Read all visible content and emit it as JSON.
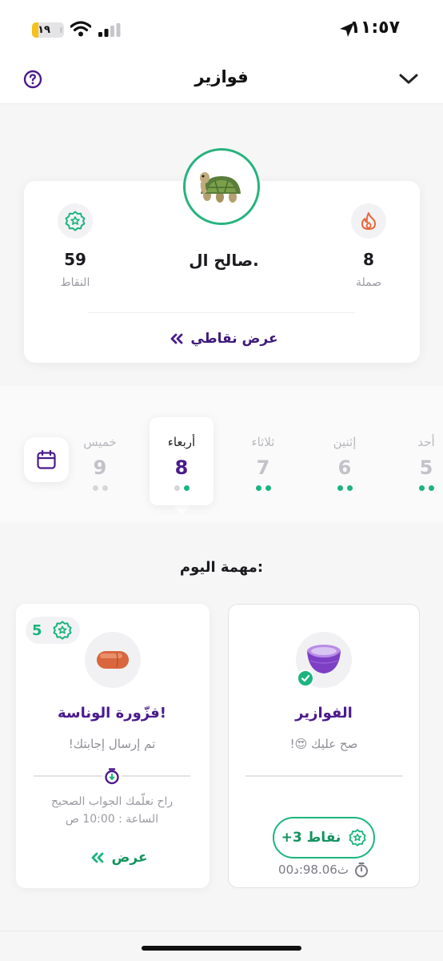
{
  "status_bar": {
    "time": "١١:٥٧",
    "battery_level": "١٩",
    "battery_fraction": 0.19,
    "icons": [
      "location-arrow-icon",
      "signal-icon",
      "wifi-icon",
      "battery-icon"
    ]
  },
  "header": {
    "title": "فوازير",
    "left_icon": "help-circle-icon",
    "right_icon": "chevron-down-icon"
  },
  "profile": {
    "user_name": "صالح ال.",
    "avatar_icon": "turtle-icon",
    "streak": {
      "value": "8",
      "label": "صملة",
      "icon": "flame-icon"
    },
    "points": {
      "value": "59",
      "label": "النقاط",
      "icon": "star-badge-icon"
    },
    "link_label": "عرض نقاطي"
  },
  "days": [
    {
      "name": "أحد",
      "number": "5",
      "dots": [
        "green",
        "green"
      ]
    },
    {
      "name": "إثنين",
      "number": "6",
      "dots": [
        "green",
        "green"
      ]
    },
    {
      "name": "ثلاثاء",
      "number": "7",
      "dots": [
        "green",
        "green"
      ]
    },
    {
      "name": "أربعاء",
      "number": "8",
      "dots": [
        "grey",
        "green"
      ],
      "selected": true
    },
    {
      "name": "خميس",
      "number": "9",
      "dots": [
        "grey",
        "grey"
      ]
    }
  ],
  "task_section": {
    "title": "مهمة اليوم:"
  },
  "tasks": {
    "fawazir": {
      "name": "الفوازير",
      "subtitle": "صح عليك 😍!",
      "points_label": "+3 نقاط",
      "timer": "ث98.06:د00",
      "completed": true,
      "icon": "bowl-icon"
    },
    "nawasa": {
      "name": "فزّورة الوناسة!",
      "subtitle": "تم إرسال إجابتك!",
      "star_count": "5",
      "note_line1": "راح نعلّمك الجواب الصحيح",
      "note_line2": "الساعة : 10:00 ص",
      "view_label": "عرض",
      "icon": "date-fruit-icon"
    }
  },
  "colors": {
    "brand_purple": "#4a1b8c",
    "accent_green": "#1bb57d",
    "streak_orange": "#e8673a"
  }
}
